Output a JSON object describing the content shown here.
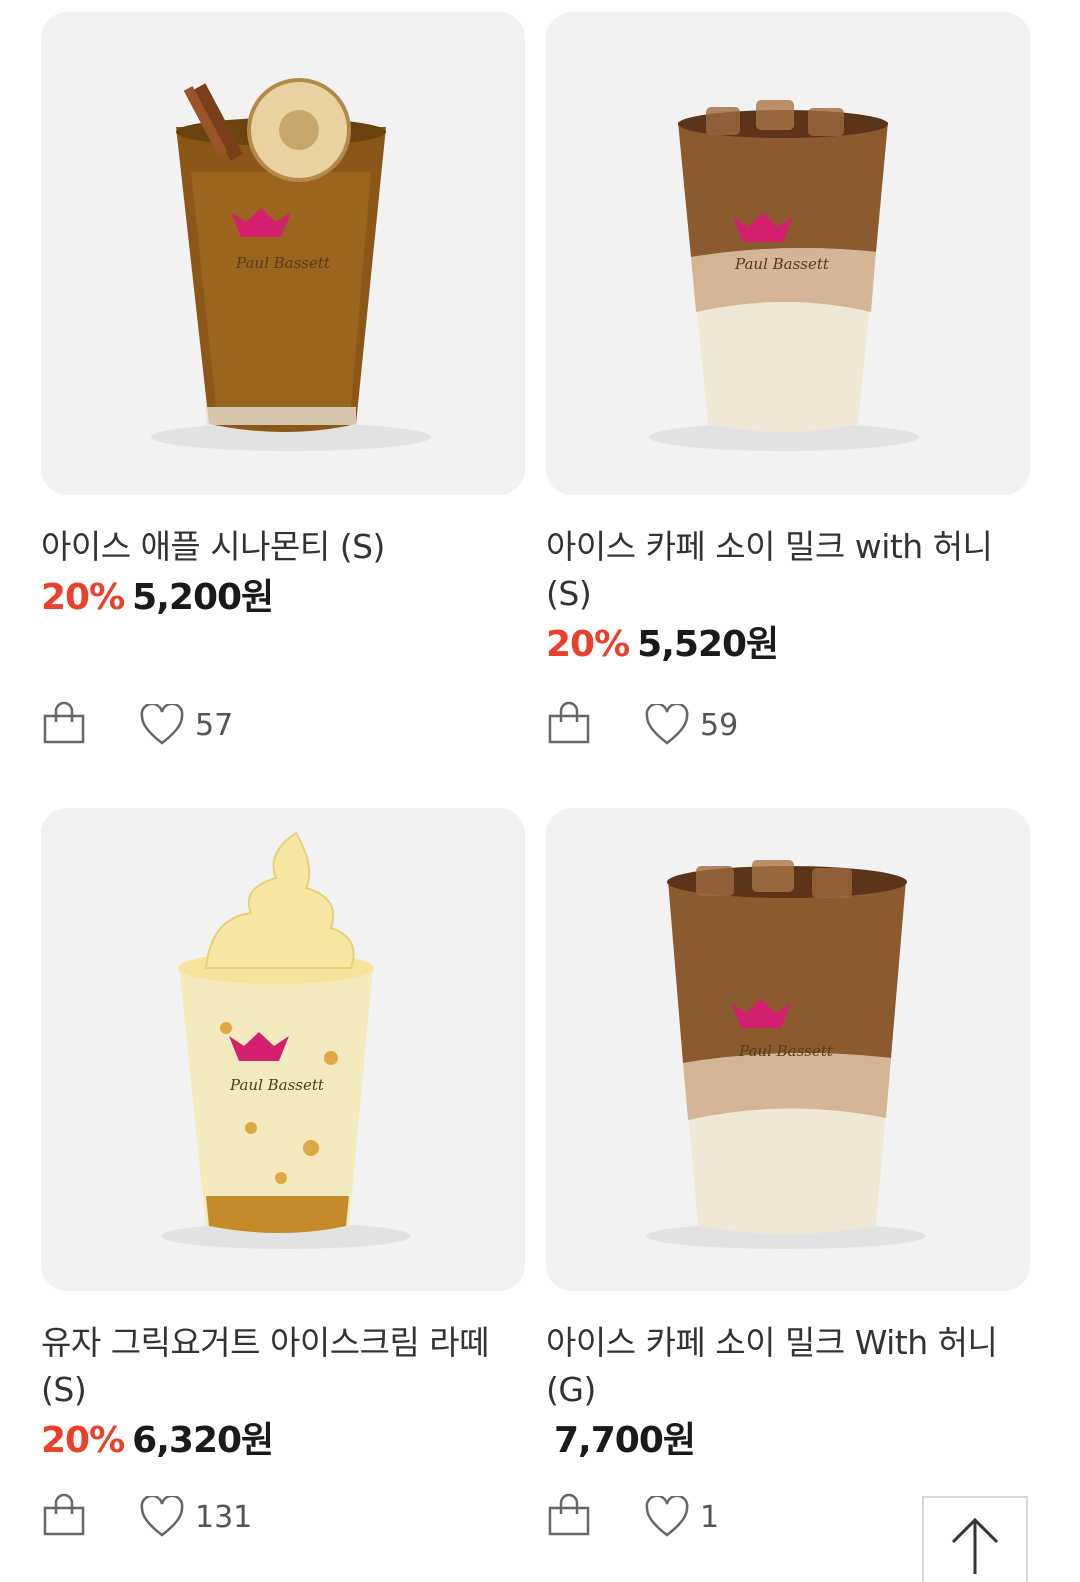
{
  "products": [
    {
      "name": "아이스 애플 시나몬티 (S)",
      "discount": "20%",
      "price": "5,200원",
      "likes": "57"
    },
    {
      "name": "아이스 카페 소이 밀크 with 허니 (S)",
      "discount": "20%",
      "price": "5,520원",
      "likes": "59"
    },
    {
      "name": "유자 그릭요거트 아이스크림 라떼 (S)",
      "discount": "20%",
      "price": "6,320원",
      "likes": "131"
    },
    {
      "name": "아이스 카페 소이 밀크 With 허니 (G)",
      "discount": "",
      "price": "7,700원",
      "likes": "1"
    }
  ],
  "icons": {
    "cart": "shopping-bag-icon",
    "like": "heart-icon",
    "scroll_top": "arrow-up-icon"
  },
  "colors": {
    "discount": "#e8412c",
    "card_bg": "#f2f2f2",
    "brand_crown": "#d21f6e"
  }
}
